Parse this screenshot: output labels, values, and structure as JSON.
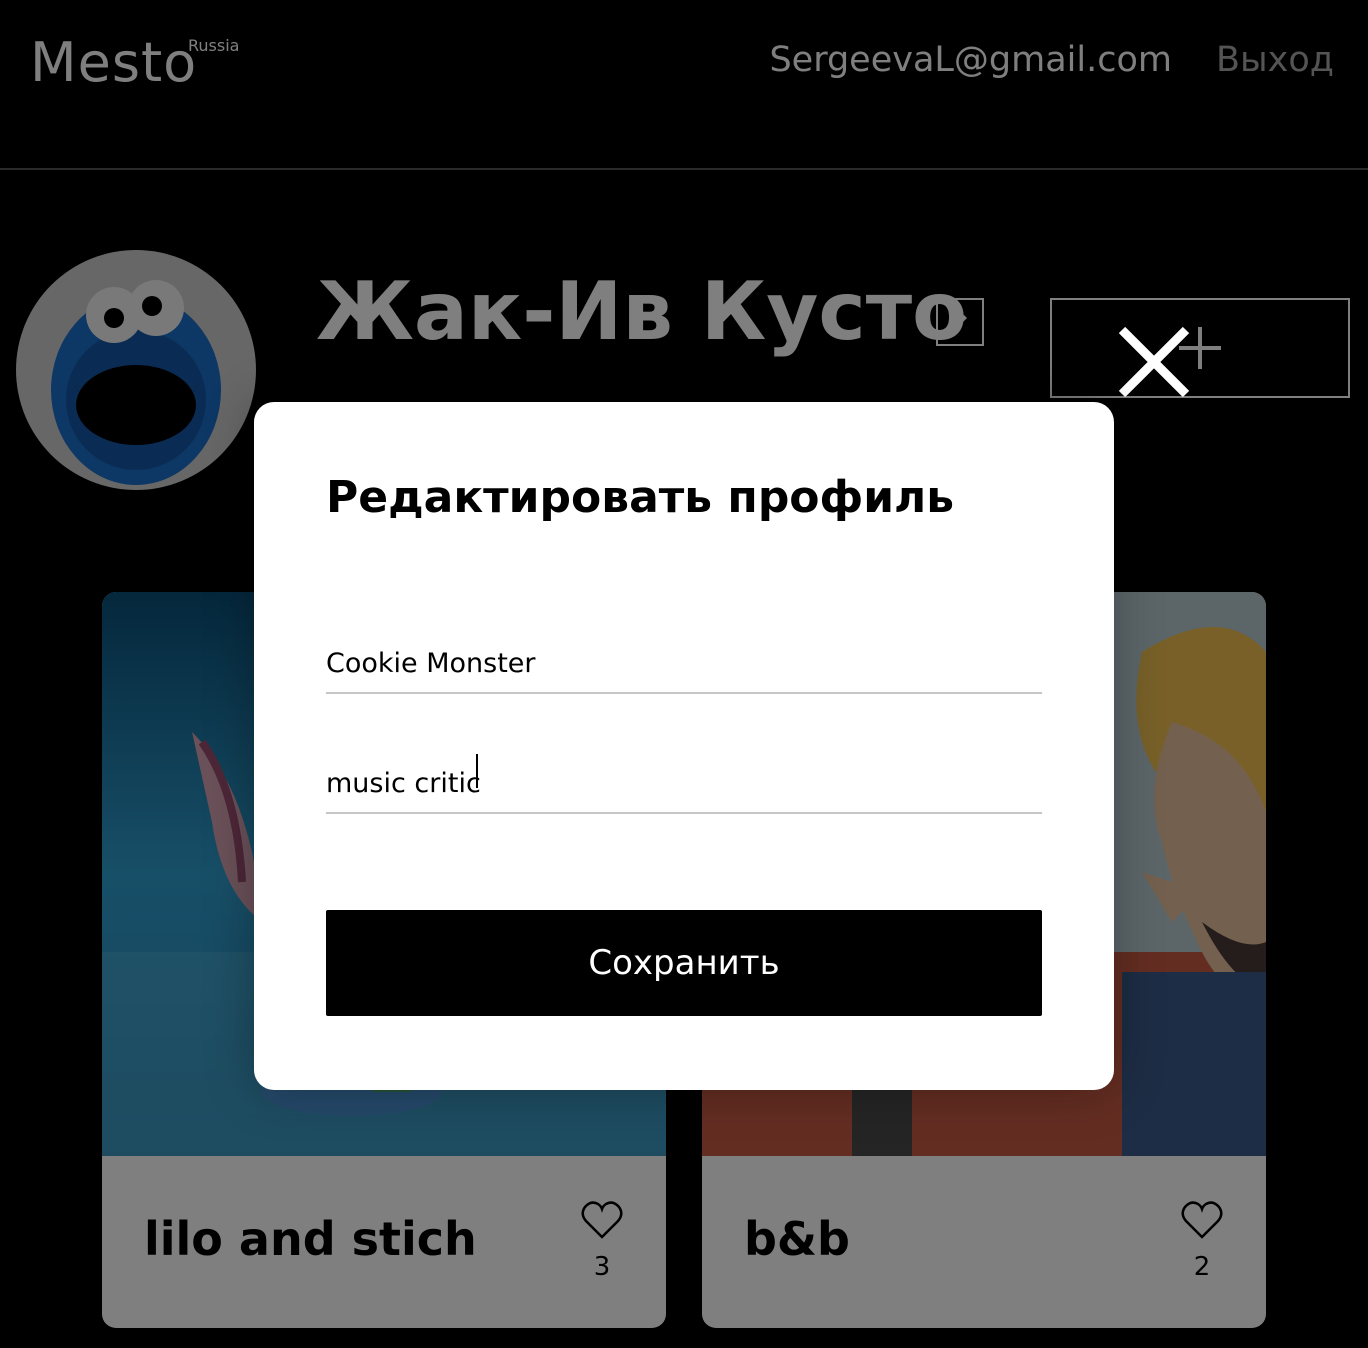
{
  "header": {
    "logo": "Mesto",
    "logo_sub": "Russia",
    "email": "SergeevaL@gmail.com",
    "logout": "Выход"
  },
  "profile": {
    "name": "Жак-Ив Кусто",
    "avatar_icon": "cookie-monster-avatar",
    "edit_icon": "pencil-icon",
    "add_icon": "plus-icon"
  },
  "cards": [
    {
      "title": "lilo and stich",
      "likes": "3",
      "image": "stitch-image"
    },
    {
      "title": "b&b",
      "likes": "2",
      "image": "beavis-butthead-image"
    }
  ],
  "popup": {
    "title": "Редактировать профиль",
    "name_value": "Cookie Monster",
    "about_value": "music critic",
    "save_label": "Сохранить",
    "close_icon": "close-icon"
  },
  "colors": {
    "background": "#000000",
    "popup_bg": "#ffffff",
    "overlay": "rgba(0,0,0,0.5)",
    "button_bg": "#000000",
    "logout_text": "#a9a9a9"
  }
}
